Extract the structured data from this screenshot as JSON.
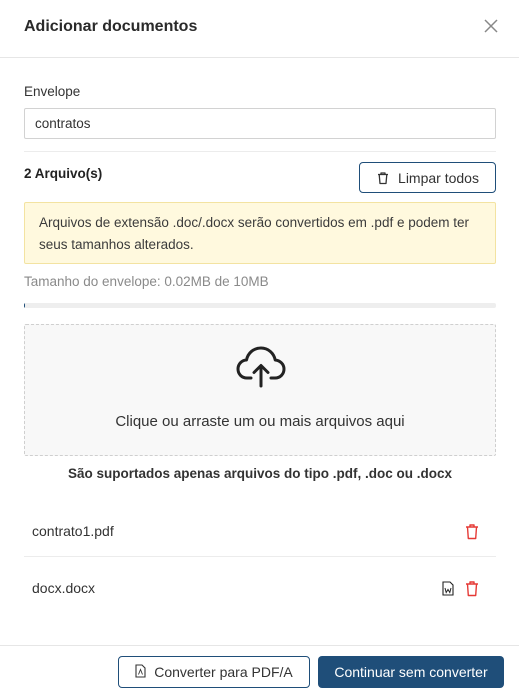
{
  "dialog": {
    "title": "Adicionar documentos",
    "close_icon": "close-icon"
  },
  "envelope": {
    "label": "Envelope",
    "value": "contratos"
  },
  "files_header": {
    "count_text": "2 Arquivo(s)",
    "clear_all_label": "Limpar todos",
    "clear_icon": "trash-icon"
  },
  "warning": {
    "text": "Arquivos de extensão .doc/.docx serão convertidos em .pdf e podem ter seus tamanhos alterados.",
    "bg_color": "#fff9de"
  },
  "size": {
    "text": "Tamanho do envelope: 0.02MB de 10MB",
    "progress_fraction": 0.002
  },
  "dropzone": {
    "icon": "cloud-upload-icon",
    "text": "Clique ou arraste um ou mais arquivos aqui"
  },
  "supported_text": "São suportados apenas arquivos do tipo .pdf, .doc ou .docx",
  "files": [
    {
      "name": "contrato1.pdf",
      "icons": [
        "trash-icon"
      ]
    },
    {
      "name": "docx.docx",
      "icons": [
        "word-document-icon",
        "trash-icon"
      ]
    }
  ],
  "footer": {
    "convert_pdfa_label": "Converter para PDF/A",
    "continue_label": "Continuar sem converter"
  },
  "colors": {
    "primary": "#1f4e79",
    "danger": "#e53935"
  }
}
